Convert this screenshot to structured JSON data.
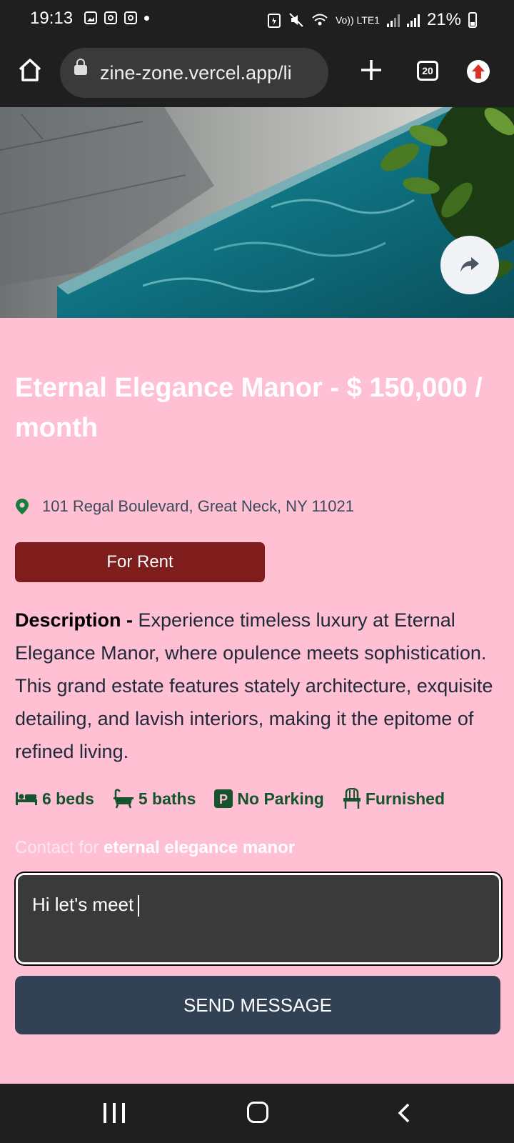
{
  "status_bar": {
    "time": "19:13",
    "signal_label": "Vo)) LTE1",
    "battery": "21%"
  },
  "browser": {
    "url": "zine-zone.vercel.app/li",
    "tab_count": "20"
  },
  "listing": {
    "title": "Eternal Elegance Manor - $ 150,000 / month",
    "address": "101 Regal Boulevard, Great Neck, NY 11021",
    "type_badge": "For Rent",
    "description_label": "Description - ",
    "description_text": "Experience timeless luxury at Eternal Elegance Manor, where opulence meets sophistication. This grand estate features stately architecture, exquisite detailing, and lavish interiors, making it the epitome of refined living.",
    "features": {
      "beds": "6 beds",
      "baths": "5 baths",
      "parking": "No Parking",
      "furnished": "Furnished"
    },
    "contact_prefix": "Contact for ",
    "contact_name": "eternal elegance manor",
    "message_text": "Hi let's meet",
    "send_label": "SEND MESSAGE"
  },
  "colors": {
    "page_bg": "#ffc0d4",
    "badge_bg": "#7f1d1d",
    "feature_text": "#14532d",
    "send_bg": "#334155"
  },
  "icons": [
    "home-icon",
    "lock-icon",
    "plus-icon",
    "tab-switcher-icon",
    "browser-update-icon",
    "share-icon",
    "location-pin-icon",
    "bed-icon",
    "bath-icon",
    "parking-icon",
    "chair-icon",
    "nav-recents-icon",
    "nav-home-icon",
    "nav-back-icon"
  ]
}
